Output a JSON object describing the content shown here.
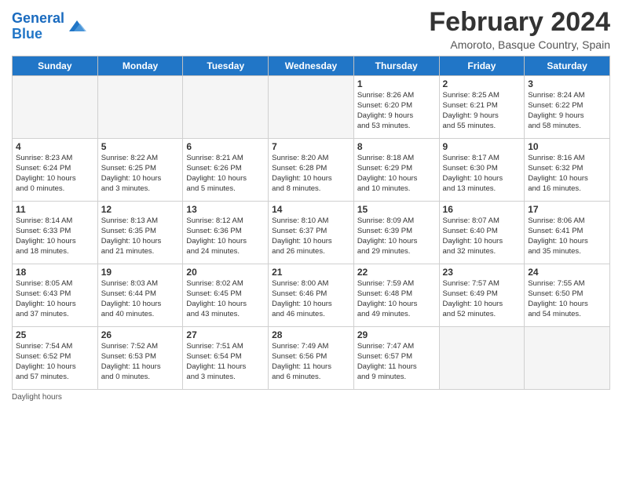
{
  "header": {
    "title": "February 2024",
    "subtitle": "Amoroto, Basque Country, Spain"
  },
  "logo": {
    "line1": "General",
    "line2": "Blue"
  },
  "days_of_week": [
    "Sunday",
    "Monday",
    "Tuesday",
    "Wednesday",
    "Thursday",
    "Friday",
    "Saturday"
  ],
  "weeks": [
    [
      {
        "day": "",
        "info": ""
      },
      {
        "day": "",
        "info": ""
      },
      {
        "day": "",
        "info": ""
      },
      {
        "day": "",
        "info": ""
      },
      {
        "day": "1",
        "info": "Sunrise: 8:26 AM\nSunset: 6:20 PM\nDaylight: 9 hours\nand 53 minutes."
      },
      {
        "day": "2",
        "info": "Sunrise: 8:25 AM\nSunset: 6:21 PM\nDaylight: 9 hours\nand 55 minutes."
      },
      {
        "day": "3",
        "info": "Sunrise: 8:24 AM\nSunset: 6:22 PM\nDaylight: 9 hours\nand 58 minutes."
      }
    ],
    [
      {
        "day": "4",
        "info": "Sunrise: 8:23 AM\nSunset: 6:24 PM\nDaylight: 10 hours\nand 0 minutes."
      },
      {
        "day": "5",
        "info": "Sunrise: 8:22 AM\nSunset: 6:25 PM\nDaylight: 10 hours\nand 3 minutes."
      },
      {
        "day": "6",
        "info": "Sunrise: 8:21 AM\nSunset: 6:26 PM\nDaylight: 10 hours\nand 5 minutes."
      },
      {
        "day": "7",
        "info": "Sunrise: 8:20 AM\nSunset: 6:28 PM\nDaylight: 10 hours\nand 8 minutes."
      },
      {
        "day": "8",
        "info": "Sunrise: 8:18 AM\nSunset: 6:29 PM\nDaylight: 10 hours\nand 10 minutes."
      },
      {
        "day": "9",
        "info": "Sunrise: 8:17 AM\nSunset: 6:30 PM\nDaylight: 10 hours\nand 13 minutes."
      },
      {
        "day": "10",
        "info": "Sunrise: 8:16 AM\nSunset: 6:32 PM\nDaylight: 10 hours\nand 16 minutes."
      }
    ],
    [
      {
        "day": "11",
        "info": "Sunrise: 8:14 AM\nSunset: 6:33 PM\nDaylight: 10 hours\nand 18 minutes."
      },
      {
        "day": "12",
        "info": "Sunrise: 8:13 AM\nSunset: 6:35 PM\nDaylight: 10 hours\nand 21 minutes."
      },
      {
        "day": "13",
        "info": "Sunrise: 8:12 AM\nSunset: 6:36 PM\nDaylight: 10 hours\nand 24 minutes."
      },
      {
        "day": "14",
        "info": "Sunrise: 8:10 AM\nSunset: 6:37 PM\nDaylight: 10 hours\nand 26 minutes."
      },
      {
        "day": "15",
        "info": "Sunrise: 8:09 AM\nSunset: 6:39 PM\nDaylight: 10 hours\nand 29 minutes."
      },
      {
        "day": "16",
        "info": "Sunrise: 8:07 AM\nSunset: 6:40 PM\nDaylight: 10 hours\nand 32 minutes."
      },
      {
        "day": "17",
        "info": "Sunrise: 8:06 AM\nSunset: 6:41 PM\nDaylight: 10 hours\nand 35 minutes."
      }
    ],
    [
      {
        "day": "18",
        "info": "Sunrise: 8:05 AM\nSunset: 6:43 PM\nDaylight: 10 hours\nand 37 minutes."
      },
      {
        "day": "19",
        "info": "Sunrise: 8:03 AM\nSunset: 6:44 PM\nDaylight: 10 hours\nand 40 minutes."
      },
      {
        "day": "20",
        "info": "Sunrise: 8:02 AM\nSunset: 6:45 PM\nDaylight: 10 hours\nand 43 minutes."
      },
      {
        "day": "21",
        "info": "Sunrise: 8:00 AM\nSunset: 6:46 PM\nDaylight: 10 hours\nand 46 minutes."
      },
      {
        "day": "22",
        "info": "Sunrise: 7:59 AM\nSunset: 6:48 PM\nDaylight: 10 hours\nand 49 minutes."
      },
      {
        "day": "23",
        "info": "Sunrise: 7:57 AM\nSunset: 6:49 PM\nDaylight: 10 hours\nand 52 minutes."
      },
      {
        "day": "24",
        "info": "Sunrise: 7:55 AM\nSunset: 6:50 PM\nDaylight: 10 hours\nand 54 minutes."
      }
    ],
    [
      {
        "day": "25",
        "info": "Sunrise: 7:54 AM\nSunset: 6:52 PM\nDaylight: 10 hours\nand 57 minutes."
      },
      {
        "day": "26",
        "info": "Sunrise: 7:52 AM\nSunset: 6:53 PM\nDaylight: 11 hours\nand 0 minutes."
      },
      {
        "day": "27",
        "info": "Sunrise: 7:51 AM\nSunset: 6:54 PM\nDaylight: 11 hours\nand 3 minutes."
      },
      {
        "day": "28",
        "info": "Sunrise: 7:49 AM\nSunset: 6:56 PM\nDaylight: 11 hours\nand 6 minutes."
      },
      {
        "day": "29",
        "info": "Sunrise: 7:47 AM\nSunset: 6:57 PM\nDaylight: 11 hours\nand 9 minutes."
      },
      {
        "day": "",
        "info": ""
      },
      {
        "day": "",
        "info": ""
      }
    ]
  ],
  "footer": "Daylight hours"
}
